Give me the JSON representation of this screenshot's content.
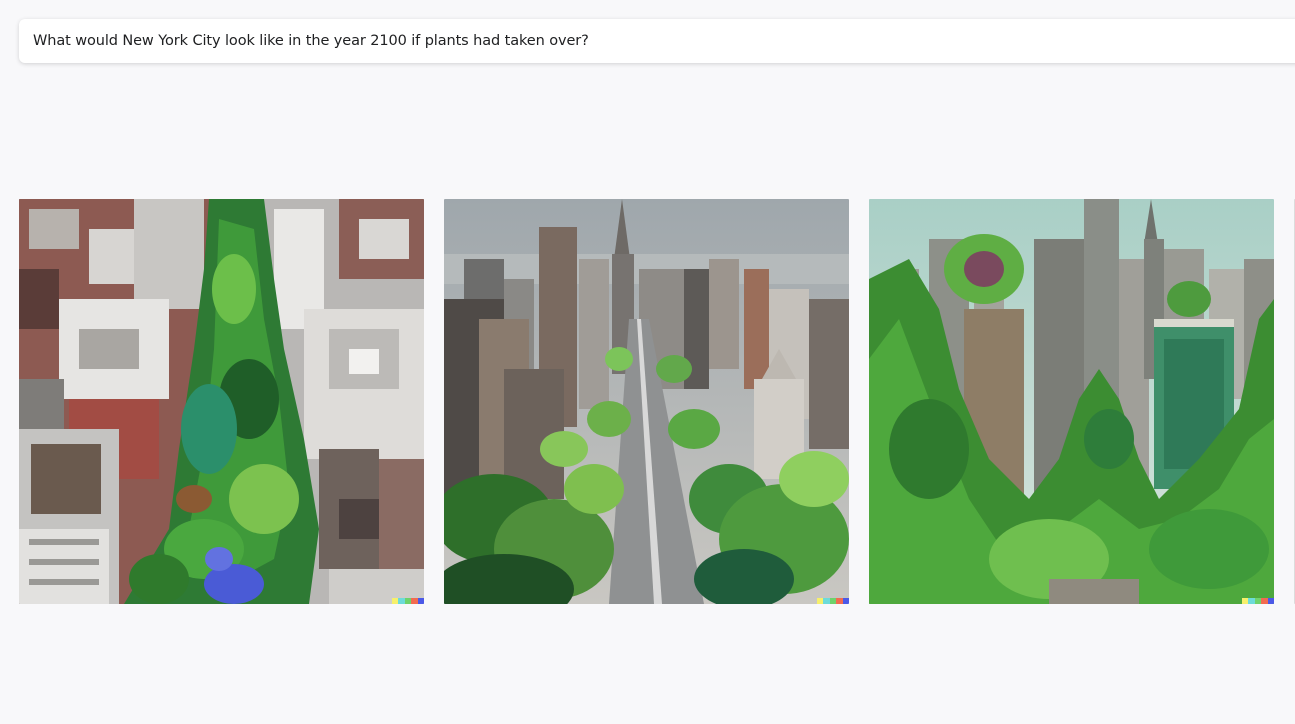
{
  "prompt": {
    "text": "What would New York City look like in the year 2100 if plants had taken over?"
  },
  "images": [
    {
      "name": "overgrown-aerial-avenue"
    },
    {
      "name": "overgrown-street-skyline"
    },
    {
      "name": "overgrown-midtown-skyline"
    }
  ],
  "signature_colors": [
    "#f7f06b",
    "#6ddbd9",
    "#6fd26b",
    "#f26b50",
    "#4b59e8"
  ],
  "colors": {
    "background": "#f8f8fa",
    "prompt_bg": "#ffffff",
    "prompt_text": "#202123"
  }
}
